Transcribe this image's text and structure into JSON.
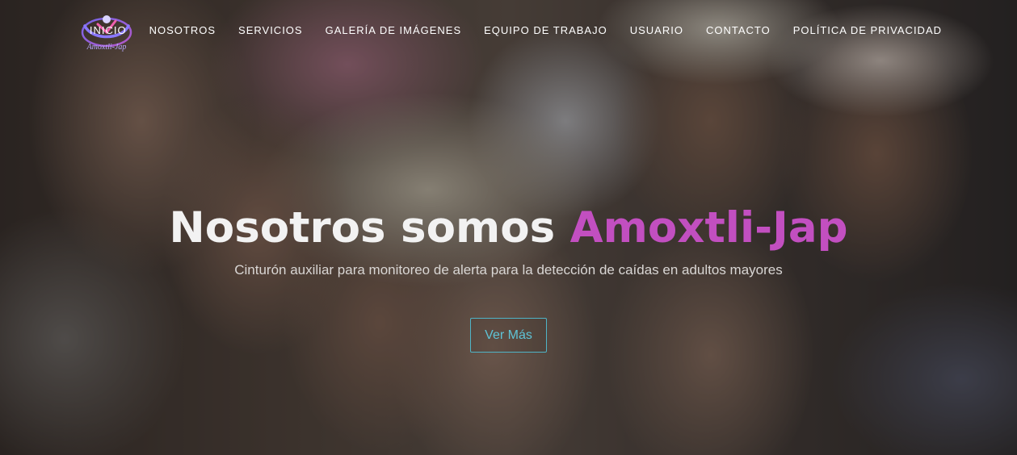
{
  "logo": {
    "text": "Amoxtli-Jap",
    "icon": "person-embrace-logo"
  },
  "nav": {
    "items": [
      {
        "label": "INICIO"
      },
      {
        "label": "NOSOTROS"
      },
      {
        "label": "SERVICIOS"
      },
      {
        "label": "GALERÍA DE IMÁGENES"
      },
      {
        "label": "EQUIPO DE TRABAJO"
      },
      {
        "label": "USUARIO"
      },
      {
        "label": "CONTACTO"
      },
      {
        "label": "POLÍTICA DE PRIVACIDAD"
      }
    ]
  },
  "hero": {
    "title_prefix": "Nosotros somos ",
    "title_brand": "Amoxtli-Jap",
    "subtitle": "Cinturón auxiliar para monitoreo de alerta para la detección de caídas en adultos mayores",
    "cta_label": "Ver Más"
  },
  "colors": {
    "brand": "#c24fc0",
    "cta": "#4fb4c7",
    "nav_text": "#ffffff"
  }
}
